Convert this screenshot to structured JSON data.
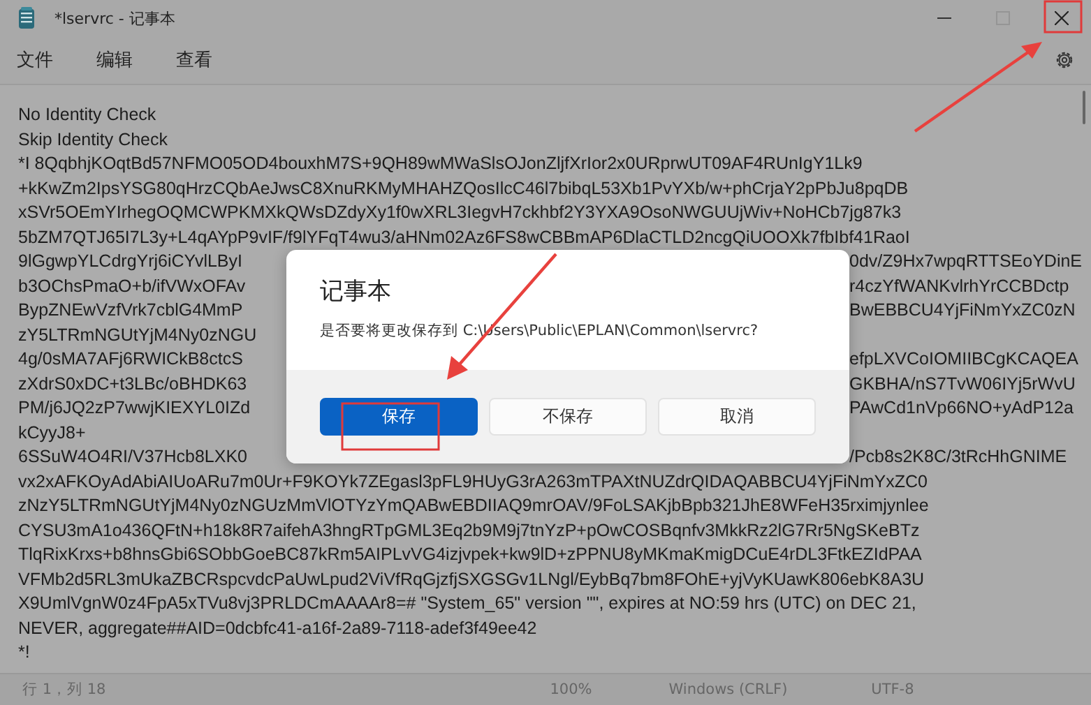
{
  "window": {
    "title": "*lservrc - 记事本"
  },
  "menu": [
    {
      "label": "文件"
    },
    {
      "label": "编辑"
    },
    {
      "label": "查看"
    }
  ],
  "editor": {
    "lines": [
      {
        "text": "No Identity Check"
      },
      {
        "text": "Skip Identity Check"
      },
      {
        "text": "*I 8QqbhjKOqtBd57NFMO05OD4bouxhM7S+9QH89wMWaSlsOJonZljfXrIor2x0URprwUT09AF4RUnIgY1Lk9"
      },
      {
        "text": "+kKwZm2IpsYSG80qHrzCQbAeJwsC8XnuRKMyMHAHZQosIlcC46l7bibqL53Xb1PvYXb/w+phCrjaY2pPbJu8pqDB"
      },
      {
        "text": "xSVr5OEmYIrhegOQMCWPKMXkQWsDZdyXy1f0wXRL3IegvH7ckhbf2Y3YXA9OsoNWGUUjWiv+NoHCb7jg87k3"
      },
      {
        "text": "5bZM7QTJ65I7L3y+L4qAYpP9vIF/f9lYFqT4wu3/aHNm02Az6FS8wCBBmAP6DlaCTLD2ncgQiUOOXk7fbIbf41RaoI"
      },
      {
        "left": "9lGgwpYLCdrgYrj6iCYvlLByI",
        "right": "0dv/Z9Hx7wpqRTTSEoYDinE"
      },
      {
        "left": "b3OChsPmaO+b/ifVWxOFAv",
        "right": "r4czYfWANKvlrhYrCCBDctp"
      },
      {
        "left": "BypZNEwVzfVrk7cblG4MmP",
        "right": "BwEBBCU4YjFiNmYxZC0zN"
      },
      {
        "left": "zY5LTRmNGUtYjM4Ny0zNGU"
      },
      {
        "left": "4g/0sMA7AFj6RWICkB8ctcS",
        "right": "efpLXVCoIOMIIBCgKCAQEA"
      },
      {
        "left": "zXdrS0xDC+t3LBc/oBHDK63",
        "right": "GKBHA/nS7TvW06IYj5rWvU"
      },
      {
        "left": "PM/j6JQ2zP7wwjKIEXYL0IZd",
        "right": "PAwCd1nVp66NO+yAdP12a"
      },
      {
        "left": "kCyyJ8+"
      },
      {
        "left": "6SSuW4O4RI/V37Hcb8LXK0",
        "right": "/Pcb8s2K8C/3tRcHhGNIME"
      },
      {
        "text": "vx2xAFKOyAdAbiAIUoARu7m0Ur+F9KOYk7ZEgasl3pFL9HUyG3rA263mTPAXtNUZdrQIDAQABBCU4YjFiNmYxZC0"
      },
      {
        "text": "zNzY5LTRmNGUtYjM4Ny0zNGUzMmVlOTYzYmQABwEBDIIAQ9mrOAV/9FoLSAKjbBpb321JhE8WFeH35rximjynlee"
      },
      {
        "text": "CYSU3mA1o436QFtN+h18k8R7aifehA3hngRTpGML3Eq2b9M9j7tnYzP+pOwCOSBqnfv3MkkRz2lG7Rr5NgSKeBTz"
      },
      {
        "text": "TlqRixKrxs+b8hnsGbi6SObbGoeBC87kRm5AIPLvVG4izjvpek+kw9lD+zPPNU8yMKmaKmigDCuE4rDL3FtkEZIdPAA"
      },
      {
        "text": "VFMb2d5RL3mUkaZBCRspcvdcPaUwLpud2ViVfRqGjzfjSXGSGv1LNgl/EybBq7bm8FOhE+yjVyKUawK806ebK8A3U"
      },
      {
        "text": "X9UmlVgnW0z4FpA5xTVu8vj3PRLDCmAAAAr8=# \"System_65\" version \"\", expires at NO:59 hrs (UTC) on DEC 21,"
      },
      {
        "text": "NEVER, aggregate##AID=0dcbfc41-a16f-2a89-7118-adef3f49ee42"
      },
      {
        "text": "*!"
      }
    ]
  },
  "dialog": {
    "title": "记事本",
    "message": "是否要将更改保存到 C:\\Users\\Public\\EPLAN\\Common\\lservrc?",
    "buttons": [
      {
        "label": "保存",
        "primary": true
      },
      {
        "label": "不保存",
        "primary": false
      },
      {
        "label": "取消",
        "primary": false
      }
    ]
  },
  "status_bar": {
    "position": "行 1，列 18",
    "zoom": "100%",
    "line_ending": "Windows (CRLF)",
    "encoding": "UTF-8"
  }
}
